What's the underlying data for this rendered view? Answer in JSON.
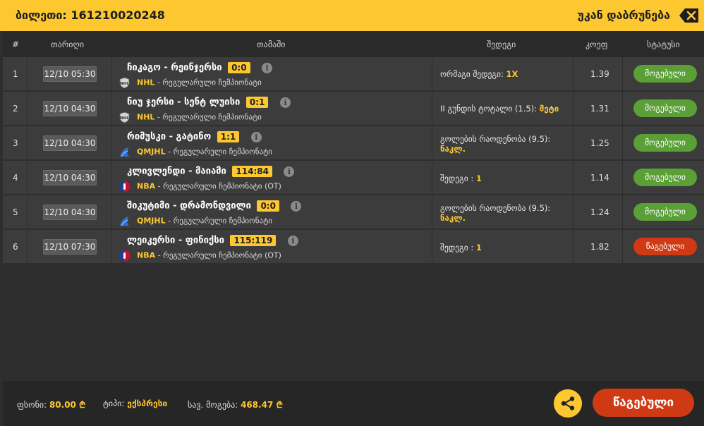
{
  "header": {
    "ticket_label": "ბილეთი: 161210020248",
    "back_label": "უკან დაბრუნება"
  },
  "columns": {
    "num": "#",
    "date": "თარიღი",
    "match": "თამაში",
    "result": "შედეგი",
    "odd": "კოეფ",
    "status": "სტატუსი"
  },
  "rows": [
    {
      "num": "1",
      "date": "12/10 05:30",
      "match": "ჩიკაგო - რეინჯერსი",
      "score": "0:0",
      "league": "NHL",
      "league_desc": " - რეგულარული ჩემპიონატი",
      "result_label": "ორმაგი შედეგი: ",
      "result_value": "1X",
      "odd": "1.39",
      "status": "მოგებული"
    },
    {
      "num": "2",
      "date": "12/10 04:30",
      "match": "ნიუ ჯერსი - სენტ ლუისი",
      "score": "0:1",
      "league": "NHL",
      "league_desc": " - რეგულარული ჩემპიონატი",
      "result_label": "II გუნდის ტოტალი (1.5): ",
      "result_value": "მეტი",
      "odd": "1.31",
      "status": "მოგებული"
    },
    {
      "num": "3",
      "date": "12/10 04:30",
      "match": "რიმუსკი - გატინო",
      "score": "1:1",
      "league": "QMJHL",
      "league_desc": " - რეგულარული ჩემპიონატი",
      "result_label": "გოლების რაოდენობა (9.5):",
      "result_value": "ნაკლ.",
      "odd": "1.25",
      "status": "მოგებული"
    },
    {
      "num": "4",
      "date": "12/10 04:30",
      "match": "კლივლენდი - მაიამი",
      "score": "114:84",
      "league": "NBA",
      "league_desc": " - რეგულარული ჩემპიონატი (OT)",
      "result_label": "შედეგი : ",
      "result_value": "1",
      "odd": "1.14",
      "status": "მოგებული"
    },
    {
      "num": "5",
      "date": "12/10 04:30",
      "match": "შიკუტიმი - დრამონდვილი",
      "score": "0:0",
      "league": "QMJHL",
      "league_desc": " - რეგულარული ჩემპიონატი",
      "result_label": "გოლების რაოდენობა (9.5):",
      "result_value": "ნაკლ.",
      "odd": "1.24",
      "status": "მოგებული"
    },
    {
      "num": "6",
      "date": "12/10 07:30",
      "match": "ლეიკერსი - ფინიქსი",
      "score": "115:119",
      "league": "NBA",
      "league_desc": " - რეგულარული ჩემპიონატი (OT)",
      "result_label": "შედეგი : ",
      "result_value": "1",
      "odd": "1.82",
      "status": "წაგებული"
    }
  ],
  "footer": {
    "stake_label": "ფსონი: ",
    "stake_value": "80.00 ₾",
    "type_label": "ტიპი: ",
    "type_value": "ექსპრესი",
    "win_label": "სავ. მოგება: ",
    "win_value": "468.47 ₾",
    "lost_button": "წაგებული"
  },
  "colors": {
    "accent": "#fdc72f",
    "won": "#5aa036",
    "lost": "#cf3a14"
  },
  "icons": {
    "close": "backspace-close-icon",
    "share": "share-icon",
    "info": "info-icon",
    "nhl": "nhl-logo-icon",
    "qmjhl": "qmjhl-logo-icon",
    "nba": "nba-logo-icon"
  }
}
